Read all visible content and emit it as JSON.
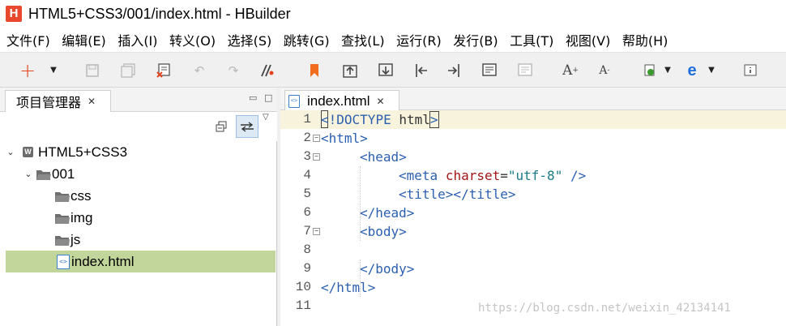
{
  "window": {
    "title": "HTML5+CSS3/001/index.html  -  HBuilder",
    "logo_text": "H"
  },
  "menu": [
    "文件(F)",
    "编辑(E)",
    "插入(I)",
    "转义(O)",
    "选择(S)",
    "跳转(G)",
    "查找(L)",
    "运行(R)",
    "发行(B)",
    "工具(T)",
    "视图(V)",
    "帮助(H)"
  ],
  "toolbar_icons": [
    "new-plus-icon",
    "save-icon",
    "save-all-icon",
    "close-file-icon",
    "undo-icon",
    "redo-icon",
    "toggle-comment-icon",
    "bookmark-icon",
    "jump-prev-icon",
    "jump-next-icon",
    "indent-left-icon",
    "indent-right-icon",
    "format-icon",
    "format-disabled-icon",
    "font-increase-icon",
    "font-decrease-icon",
    "run-browser-icon",
    "edge-browser-icon",
    "about-icon"
  ],
  "project_panel": {
    "tab_label": "项目管理器",
    "tree": [
      {
        "label": "HTML5+CSS3",
        "type": "project",
        "expanded": true,
        "level": 0
      },
      {
        "label": "001",
        "type": "folder",
        "expanded": true,
        "level": 1
      },
      {
        "label": "css",
        "type": "folder",
        "level": 2
      },
      {
        "label": "img",
        "type": "folder",
        "level": 2
      },
      {
        "label": "js",
        "type": "folder",
        "level": 2
      },
      {
        "label": "index.html",
        "type": "file",
        "level": 2,
        "selected": true
      }
    ]
  },
  "editor": {
    "tab_label": "index.html",
    "file_icon_text": "<>",
    "line_numbers": [
      "1",
      "2",
      "3",
      "4",
      "5",
      "6",
      "7",
      "8",
      "9",
      "10",
      "11"
    ],
    "lines": {
      "l1": {
        "open": "<",
        "doctype": "!DOCTYPE",
        "rest": " html",
        "close": ">"
      },
      "l2": {
        "text": "<html>"
      },
      "l3": {
        "text": "<head>"
      },
      "l4": {
        "tag": "<meta",
        "attr": "charset",
        "eq": "=",
        "value": "\"utf-8\"",
        "end": " />"
      },
      "l5": {
        "text": "<title></title>"
      },
      "l6": {
        "text": "</head>"
      },
      "l7": {
        "text": "<body>"
      },
      "l8": {
        "text": ""
      },
      "l9": {
        "text": "</body>"
      },
      "l10": {
        "text": "</html>"
      },
      "l11": {
        "text": ""
      }
    }
  },
  "watermark": "https://blog.csdn.net/weixin_42134141",
  "colors": {
    "tag": "#2b5fb0",
    "attribute": "#a31515",
    "string": "#1a7a8a",
    "selection": "#c2d59b",
    "current_line": "#f7f3dc"
  }
}
